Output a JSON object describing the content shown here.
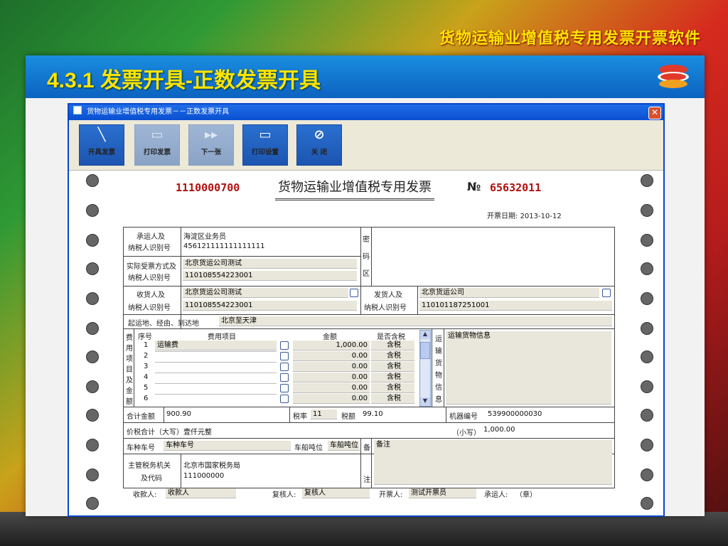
{
  "slide": {
    "title": "货物运输业增值税专用发票开票软件",
    "section": "4.3.1 发票开具-正数发票开具"
  },
  "window": {
    "title": "货物运输业增值税专用发票－－正数发票开具"
  },
  "toolbar": [
    {
      "label": "开具发票",
      "icon": "pen-icon",
      "enabled": true
    },
    {
      "label": "打印发票",
      "icon": "printer-icon",
      "enabled": false
    },
    {
      "label": "下一张",
      "icon": "next-icon",
      "enabled": false
    },
    {
      "label": "打印设置",
      "icon": "printer-settings-icon",
      "enabled": true
    },
    {
      "label": "关 闭",
      "icon": "close-circle-icon",
      "enabled": true
    }
  ],
  "invoice": {
    "code": "1110000700",
    "title": "货物运输业增值税专用发票",
    "no_symbol": "№",
    "number": "65632011",
    "issue_date_label": "开票日期:",
    "issue_date": "2013-10-12",
    "carrier": {
      "label1": "承运人及",
      "label2": "纳税人识别号",
      "name": "海淀区业务员",
      "taxid": "456121111111111111"
    },
    "actual": {
      "label1": "实际受票方式及",
      "label2": "纳税人识别号",
      "name": "北京货运公司测试",
      "taxid": "110108554223001"
    },
    "cipher_label": [
      "密",
      "码",
      "区"
    ],
    "consignee": {
      "label1": "收货人及",
      "label2": "纳税人识别号",
      "name": "北京货运公司测试",
      "taxid": "110108554223001"
    },
    "shipper": {
      "label1": "发货人及",
      "label2": "纳税人识别号",
      "name": "北京货运公司",
      "taxid": "110101187251001"
    },
    "route": {
      "label": "起运地、经由、到达地",
      "value": "北京至天津"
    },
    "fee_side_label": [
      "费",
      "用",
      "项",
      "目",
      "及",
      "金",
      "额"
    ],
    "fee_headers": {
      "seq": "序号",
      "item": "费用项目",
      "amount": "金额",
      "taxincl": "是否含税"
    },
    "fee_rows": [
      {
        "seq": "1",
        "item": "运输费",
        "amount": "1,000.00",
        "tax": "含税"
      },
      {
        "seq": "2",
        "item": "",
        "amount": "0.00",
        "tax": "含税"
      },
      {
        "seq": "3",
        "item": "",
        "amount": "0.00",
        "tax": "含税"
      },
      {
        "seq": "4",
        "item": "",
        "amount": "0.00",
        "tax": "含税"
      },
      {
        "seq": "5",
        "item": "",
        "amount": "0.00",
        "tax": "含税"
      },
      {
        "seq": "6",
        "item": "",
        "amount": "0.00",
        "tax": "含税"
      }
    ],
    "cargo_label": [
      "运",
      "输",
      "货",
      "物",
      "信",
      "息"
    ],
    "cargo_info": "运输货物信息",
    "total": {
      "label": "合计金额",
      "value": "900.90",
      "rate_label": "税率",
      "rate": "11",
      "tax_label": "税额",
      "tax": "99.10",
      "machine_label": "机器编号",
      "machine": "539900000030"
    },
    "sum": {
      "label": "价税合计（大写）",
      "upper": "壹仟元整",
      "lower_label": "（小写）",
      "lower": "1,000.00"
    },
    "vehicle": {
      "label": "车种车号",
      "value": "车种车号",
      "tonnage_label": "车船吨位",
      "tonnage": "车船吨位"
    },
    "remark_label": [
      "备",
      "注"
    ],
    "remark": "备注",
    "authority": {
      "label1": "主管税务机关",
      "label2": "及代码",
      "name": "北京市国家税务局",
      "code": "111000000"
    },
    "footer": {
      "payee_label": "收款人:",
      "payee": "收款人",
      "reviewer_label": "复核人:",
      "reviewer": "复核人",
      "drawer_label": "开票人:",
      "drawer": "测试开票员",
      "carrier_label": "承运人:",
      "carrier": "（章）"
    }
  }
}
